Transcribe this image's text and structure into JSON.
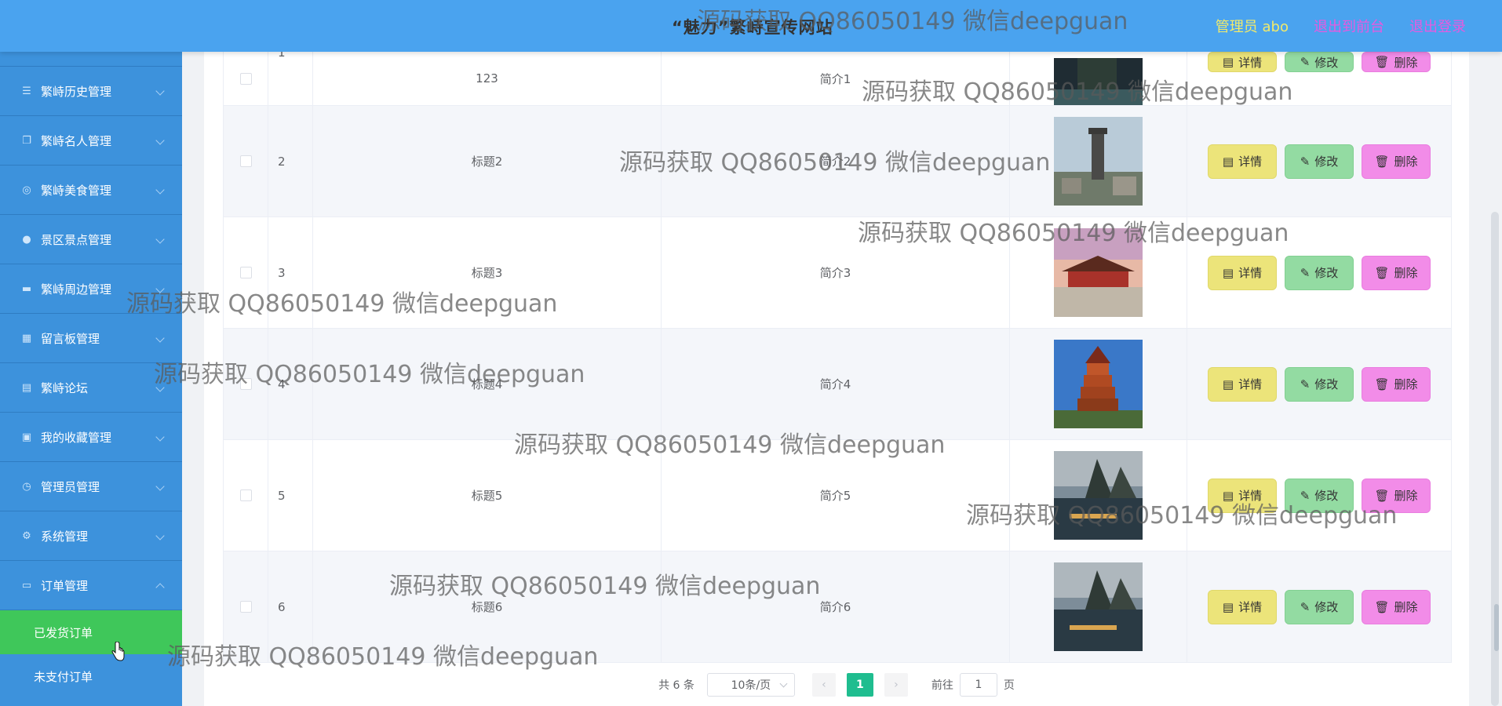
{
  "header": {
    "title": "“魅力”繁峙宣传网站",
    "user_label": "管理员 abo",
    "front_label": "退出到前台",
    "logout_label": "退出登录"
  },
  "sidebar": {
    "items": [
      {
        "label": "繁峙历史管理",
        "icon": "list-icon"
      },
      {
        "label": "繁峙名人管理",
        "icon": "copy-icon"
      },
      {
        "label": "繁峙美食管理",
        "icon": "compass-icon"
      },
      {
        "label": "景区景点管理",
        "icon": "user-icon"
      },
      {
        "label": "繁峙周边管理",
        "icon": "document-icon"
      },
      {
        "label": "留言板管理",
        "icon": "chart-icon"
      },
      {
        "label": "繁峙论坛",
        "icon": "clipboard-icon"
      },
      {
        "label": "我的收藏管理",
        "icon": "picture-icon"
      },
      {
        "label": "管理员管理",
        "icon": "clock-icon"
      },
      {
        "label": "系统管理",
        "icon": "settings-icon"
      },
      {
        "label": "订单管理",
        "icon": "monitor-icon"
      }
    ],
    "sub_items": [
      {
        "label": "已发货订单",
        "active": true
      },
      {
        "label": "未支付订单",
        "active": false
      }
    ]
  },
  "table": {
    "rows": [
      {
        "index": "1",
        "title": "123",
        "intro": "简介1"
      },
      {
        "index": "2",
        "title": "标题2",
        "intro": "简介2"
      },
      {
        "index": "3",
        "title": "标题3",
        "intro": "简介3"
      },
      {
        "index": "4",
        "title": "标题4",
        "intro": "简介4"
      },
      {
        "index": "5",
        "title": "标题5",
        "intro": "简介5"
      },
      {
        "index": "6",
        "title": "标题6",
        "intro": "简介6"
      }
    ],
    "actions": {
      "detail": "详情",
      "edit": "修改",
      "delete": "删除"
    }
  },
  "pagination": {
    "total": "共 6 条",
    "page_size": "10条/页",
    "current_page": "1",
    "goto_label": "前往",
    "goto_value": "1",
    "page_suffix": "页"
  },
  "watermark": "源码获取 QQ86050149 微信deepguan",
  "colors": {
    "header_bg": "#4aa3ef",
    "sidebar_bg": "#3d92dc",
    "active_sub": "#3fc75a",
    "detail_btn": "#ece47a",
    "edit_btn": "#93dba2",
    "delete_btn": "#f28ce8",
    "pager_active": "#1fbd8f"
  }
}
